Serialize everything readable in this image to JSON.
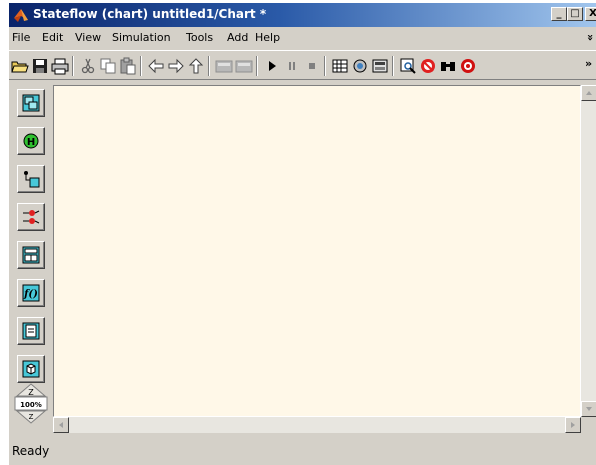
{
  "window": {
    "title": "Stateflow (chart) untitled1/Chart *",
    "controls": {
      "minimize": "_",
      "maximize": "□",
      "close": "X"
    }
  },
  "menu": {
    "items": [
      "File",
      "Edit",
      "View",
      "Simulation",
      "Tools",
      "Add",
      "Help"
    ],
    "overflow": "»"
  },
  "toolbar": {
    "icons": [
      "open-folder-icon",
      "save-icon",
      "print-icon",
      "cut-icon",
      "copy-icon",
      "paste-icon",
      "back-icon",
      "forward-icon",
      "up-icon",
      "undo-icon",
      "redo-icon",
      "start-icon",
      "pause-icon",
      "stop-icon",
      "build-icon",
      "model-explorer-icon",
      "debugger-icon",
      "zoom-selection-icon",
      "breakpoint-icon",
      "find-icon",
      "target-icon"
    ],
    "overflow": "»"
  },
  "palette": {
    "tools": [
      "state-tool-icon",
      "history-junction-icon",
      "default-transition-icon",
      "connective-junction-icon",
      "truth-table-icon",
      "graphical-function-icon",
      "embedded-matlab-icon",
      "box-icon"
    ],
    "zoom_level": "100%",
    "zoom_in": "Z",
    "zoom_out": "Z"
  },
  "status": {
    "text": "Ready"
  },
  "colors": {
    "canvas": "#fff8e8",
    "titlebar_start": "#0a246a",
    "titlebar_end": "#a6caf0"
  }
}
